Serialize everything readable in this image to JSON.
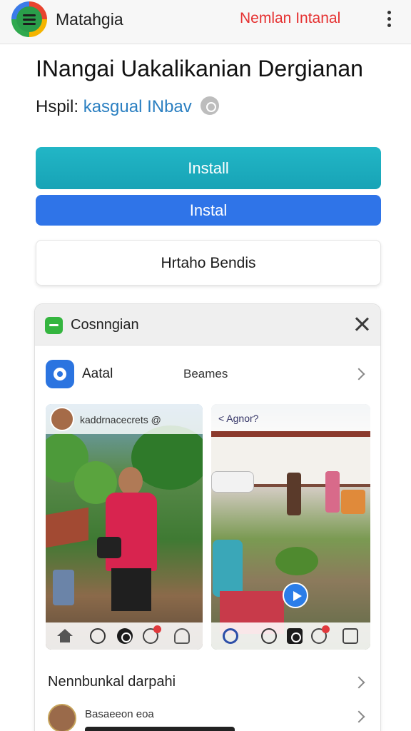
{
  "top_bar": {
    "app_name": "Matahgia",
    "link_text": "Nemlan Intanal",
    "icons": [
      "menu-icon",
      "more-vert-icon"
    ]
  },
  "app": {
    "title": "INangai Uakalikanian Dergianan",
    "developer_prefix": "Hspil:",
    "developer_name": "kasgual INbav",
    "info_icon": "info-icon"
  },
  "buttons": {
    "install_primary": "Install",
    "install_secondary": "Instal",
    "secondary_action": "Hrtaho Bendis"
  },
  "colors": {
    "install_primary": "#1aaabd",
    "install_secondary": "#2f74e8",
    "top_link": "#e53131",
    "developer_link": "#2a7fc1"
  },
  "card": {
    "title": "Cosnngian",
    "row1": {
      "title": "Aatal",
      "subtitle": "Beames"
    },
    "screenshot_left": {
      "label": "kaddrnacecrets @"
    },
    "screenshot_right": {
      "label": "< Agnor?"
    },
    "row3": {
      "title": "Nennbunkal darpahi"
    },
    "row4": {
      "title": "Basaeeon eoa"
    }
  }
}
